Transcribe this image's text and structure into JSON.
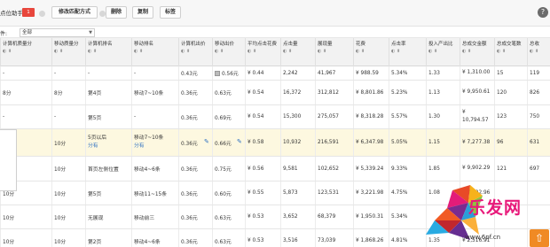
{
  "toolbar": {
    "title": "点位助手",
    "badge": "1",
    "buttons": [
      "修改匹配方式",
      "删除",
      "复制",
      "标签"
    ],
    "help_icon": "?"
  },
  "filter": {
    "label": "件:",
    "value": "全部"
  },
  "table": {
    "columns": [
      {
        "label": "计算机质量分"
      },
      {
        "label": "移动质量分"
      },
      {
        "label": "计算机排名"
      },
      {
        "label": "移动排名"
      },
      {
        "label": "计算机出价"
      },
      {
        "label": "移动出价"
      },
      {
        "label": "平均点击花费"
      },
      {
        "label": "点击量"
      },
      {
        "label": "展现量"
      },
      {
        "label": "花费"
      },
      {
        "label": "点击率"
      },
      {
        "label": "投入产出比"
      },
      {
        "label": "总成交金额"
      },
      {
        "label": "总成交笔数"
      },
      {
        "label": "总收"
      }
    ],
    "rows": [
      {
        "pc_q": "-",
        "m_q": "-",
        "pc_rank": "-",
        "m_rank": "-",
        "pc_bid": "0.43元",
        "m_bid": "0.56元",
        "cpc": "¥ 0.44",
        "clicks": "2,242",
        "impr": "41,967",
        "cost": "¥ 988.59",
        "ctr": "5.34%",
        "roi": "1.33",
        "gmv": "¥ 1,310.0\n0",
        "orders": "15",
        "extra": "119"
      },
      {
        "pc_q": "8分",
        "m_q": "8分",
        "pc_rank": "第4页",
        "m_rank": "移动7~10条",
        "pc_bid": "0.36元",
        "m_bid": "0.63元",
        "cpc": "¥ 0.54",
        "clicks": "16,372",
        "impr": "312,812",
        "cost": "¥ 8,801.86",
        "ctr": "5.23%",
        "roi": "1.13",
        "gmv": "¥ 9,950.6\n1",
        "orders": "120",
        "extra": "826"
      },
      {
        "pc_q": "-",
        "m_q": "-",
        "pc_rank": "第5页",
        "m_rank": "-",
        "pc_bid": "0.36元",
        "m_bid": "0.69元",
        "cpc": "¥ 0.54",
        "clicks": "15,300",
        "impr": "275,057",
        "cost": "¥ 8,318.28",
        "ctr": "5.57%",
        "roi": "1.30",
        "gmv": "¥ 10,794.\n57",
        "orders": "123",
        "extra": "750"
      },
      {
        "pc_q": "10分",
        "m_q": "10分",
        "pc_rank": "5页以后",
        "pc_rank2": "分有",
        "m_rank": "移动7~10条",
        "m_rank2": "分有",
        "pc_bid": "0.36元",
        "m_bid": "0.66元",
        "cpc": "¥ 0.58",
        "clicks": "10,932",
        "impr": "216,591",
        "cost": "¥ 6,347.98",
        "ctr": "5.05%",
        "roi": "1.15",
        "gmv": "¥ 7,277.3\n8",
        "orders": "96",
        "extra": "631"
      },
      {
        "pc_q": "10分",
        "m_q": "10分",
        "pc_rank": "首页左侧位置",
        "m_rank": "移动4~6条",
        "pc_bid": "0.36元",
        "m_bid": "0.75元",
        "cpc": "¥ 0.56",
        "clicks": "9,581",
        "impr": "102,652",
        "cost": "¥ 5,339.24",
        "ctr": "9.33%",
        "roi": "1.85",
        "gmv": "¥ 9,902.2\n9",
        "orders": "121",
        "extra": "697"
      },
      {
        "pc_q": "10分",
        "m_q": "10分",
        "pc_rank": "第5页",
        "m_rank": "移动11~15条",
        "pc_bid": "0.36元",
        "m_bid": "0.60元",
        "cpc": "¥ 0.55",
        "clicks": "5,873",
        "impr": "123,531",
        "cost": "¥ 3,221.98",
        "ctr": "4.75%",
        "roi": "1.08",
        "gmv": "¥ 3,492.9\n6",
        "orders": "",
        "extra": ""
      },
      {
        "pc_q": "10分",
        "m_q": "10分",
        "pc_rank": "无展现",
        "m_rank": "移动前三",
        "pc_bid": "0.36元",
        "m_bid": "0.63元",
        "cpc": "¥ 0.53",
        "clicks": "3,652",
        "impr": "68,379",
        "cost": "¥ 1,950.31",
        "ctr": "5.34%",
        "roi": "",
        "gmv": "",
        "orders": "",
        "extra": ""
      },
      {
        "pc_q": "10分",
        "m_q": "10分",
        "pc_rank": "第2页",
        "m_rank": "移动4~6条",
        "pc_bid": "0.36元",
        "m_bid": "0.63元",
        "cpc": "¥ 0.53",
        "clicks": "3,516",
        "impr": "73,039",
        "cost": "¥ 1,868.26",
        "ctr": "4.81%",
        "roi": "1.35",
        "gmv": "¥ 2,516.9\n1",
        "orders": "",
        "extra": ""
      }
    ]
  },
  "watermark": {
    "text": "乐发网",
    "url": "www.6pf.cn"
  },
  "icons": {
    "sort": "sort-arrows-icon",
    "edit": "pencil-icon",
    "help": "help-circle-icon",
    "top": "back-to-top-icon"
  }
}
